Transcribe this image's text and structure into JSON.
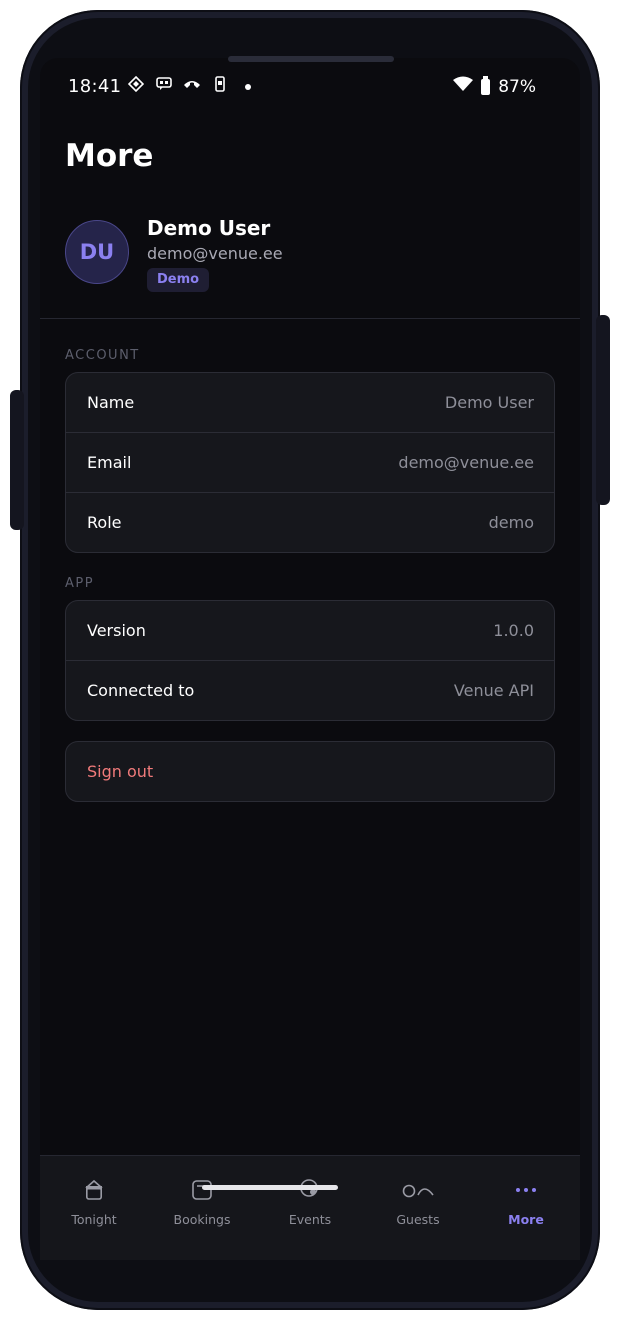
{
  "status_bar": {
    "time": "18:41",
    "battery": "87%",
    "icons": [
      "diamond-icon",
      "message-icon",
      "call-icon",
      "phone-icon",
      "dot-icon",
      "wifi-icon",
      "battery-icon"
    ]
  },
  "page": {
    "title": "More"
  },
  "profile": {
    "initials": "DU",
    "name": "Demo User",
    "email": "demo@venue.ee",
    "badge": "Demo"
  },
  "account": {
    "label": "ACCOUNT",
    "rows": [
      {
        "key": "Name",
        "value": "Demo User"
      },
      {
        "key": "Email",
        "value": "demo@venue.ee"
      },
      {
        "key": "Role",
        "value": "demo"
      }
    ]
  },
  "app": {
    "label": "APP",
    "rows": [
      {
        "key": "Version",
        "value": "1.0.0"
      },
      {
        "key": "Connected to",
        "value": "Venue API"
      }
    ]
  },
  "actions": {
    "sign_out": "Sign out"
  },
  "nav": {
    "tabs": [
      {
        "label": "Tonight",
        "icon": "house-icon"
      },
      {
        "label": "Bookings",
        "icon": "square-icon"
      },
      {
        "label": "Events",
        "icon": "circle-icon"
      },
      {
        "label": "Guests",
        "icon": "people-icon"
      },
      {
        "label": "More",
        "icon": "dots-icon"
      }
    ],
    "active": "More"
  },
  "colors": {
    "accent": "#8b80f0",
    "danger": "#f07a7a",
    "background": "#0b0b0f",
    "card": "#16171c"
  }
}
